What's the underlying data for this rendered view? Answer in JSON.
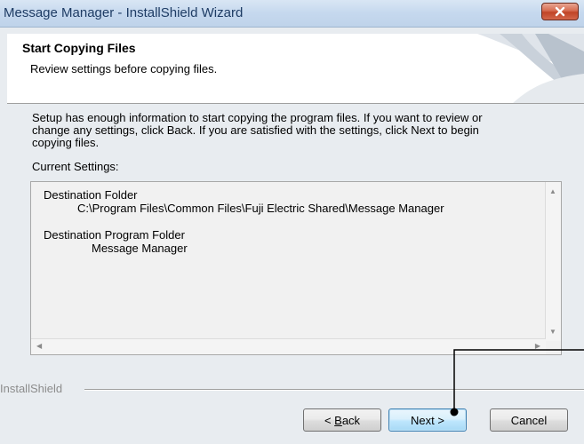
{
  "window": {
    "title": "Message Manager - InstallShield Wizard",
    "close_icon": "close-icon"
  },
  "header": {
    "title": "Start Copying Files",
    "subtitle": "Review settings before copying files."
  },
  "body": {
    "description_lines": [
      "Setup has enough information to start copying the program files.  If you want to review or",
      "change any settings, click Back.  If you are satisfied with the settings, click Next to begin",
      "copying files."
    ],
    "current_settings_label": "Current Settings:"
  },
  "settings": {
    "destination_folder_label": "Destination Folder",
    "destination_folder_value": "C:\\Program Files\\Common Files\\Fuji Electric Shared\\Message Manager",
    "program_folder_label": "Destination Program Folder",
    "program_folder_value": "Message Manager"
  },
  "footer": {
    "brand": "InstallShield"
  },
  "buttons": {
    "back_prefix": "< ",
    "back_accel": "B",
    "back_rest": "ack",
    "next": "Next >",
    "cancel": "Cancel"
  },
  "colors": {
    "close_button": "#c8452a",
    "default_button_border": "#3c7fb1",
    "callout": "#000000"
  }
}
